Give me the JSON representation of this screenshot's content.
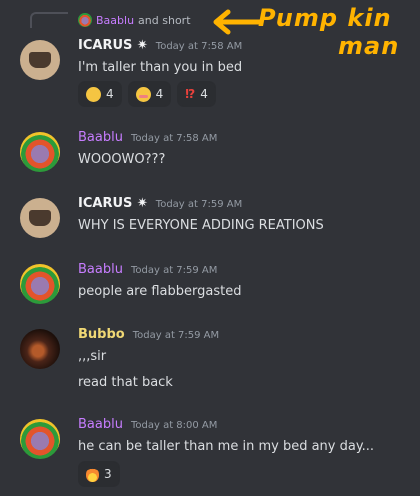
{
  "reply": {
    "username": "Baablu",
    "text": "and short"
  },
  "annotation": {
    "line1": "Pump kin",
    "line2": "man"
  },
  "messages": [
    {
      "author": "ICARUS ✷",
      "author_color": "#f2f3f5",
      "time": "Today at 7:58 AM",
      "lines": [
        "I'm taller than you in bed"
      ],
      "reactions": [
        {
          "icon": "sad-face-emoji",
          "count": "4"
        },
        {
          "icon": "flushed-face-emoji",
          "count": "4"
        },
        {
          "icon": "interrobang-emoji",
          "glyph": "⁉",
          "count": "4"
        }
      ]
    },
    {
      "author": "Baablu",
      "author_color": "#c77dff",
      "time": "Today at 7:58 AM",
      "lines": [
        "WOOOWO???"
      ]
    },
    {
      "author": "ICARUS ✷",
      "author_color": "#f2f3f5",
      "time": "Today at 7:59 AM",
      "lines": [
        "WHY IS EVERYONE ADDING REATIONS"
      ]
    },
    {
      "author": "Baablu",
      "author_color": "#c77dff",
      "time": "Today at 7:59 AM",
      "lines": [
        "people are flabbergasted"
      ]
    },
    {
      "author": "Bubbo",
      "author_color": "#f0d875",
      "time": "Today at 7:59 AM",
      "lines": [
        ",,,sir",
        "read that back"
      ]
    },
    {
      "author": "Baablu",
      "author_color": "#c77dff",
      "time": "Today at 8:00 AM",
      "lines": [
        "he can be taller than me in my bed any day..."
      ],
      "reactions": [
        {
          "icon": "fire-emoji",
          "count": "3"
        }
      ]
    }
  ]
}
